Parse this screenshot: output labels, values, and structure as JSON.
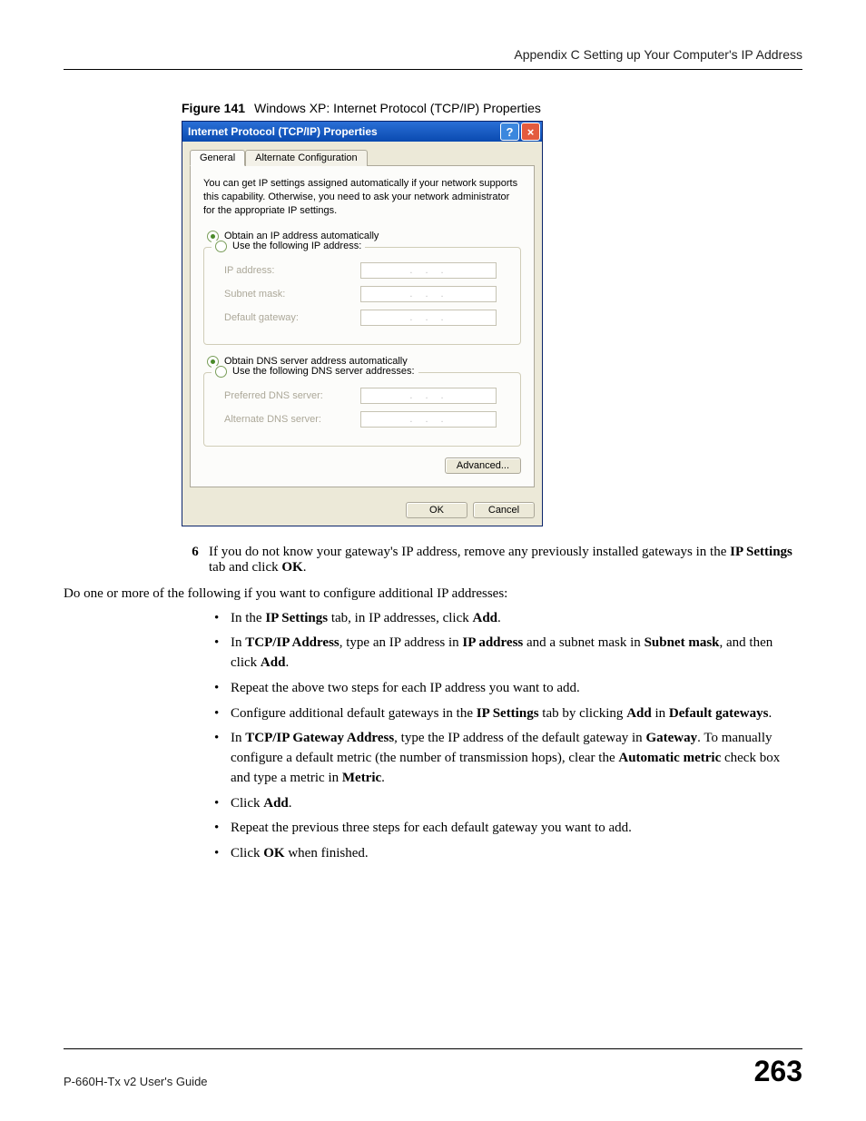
{
  "header": {
    "appendix": "Appendix C Setting up Your Computer's IP Address"
  },
  "figure": {
    "label": "Figure 141",
    "caption": "Windows XP: Internet Protocol (TCP/IP) Properties"
  },
  "dialog": {
    "title": "Internet Protocol (TCP/IP) Properties",
    "tabs": {
      "general": "General",
      "alt": "Alternate Configuration"
    },
    "description": "You can get IP settings assigned automatically if your network supports this capability. Otherwise, you need to ask your network administrator for the appropriate IP settings.",
    "radio_ip_auto": "Obtain an IP address automatically",
    "radio_ip_manual": "Use the following IP address:",
    "fields": {
      "ip_address": "IP address:",
      "subnet_mask": "Subnet mask:",
      "default_gateway": "Default gateway:"
    },
    "radio_dns_auto": "Obtain DNS server address automatically",
    "radio_dns_manual": "Use the following DNS server addresses:",
    "dns_fields": {
      "preferred": "Preferred DNS server:",
      "alternate": "Alternate DNS server:"
    },
    "advanced": "Advanced...",
    "ok": "OK",
    "cancel": "Cancel",
    "ip_placeholder": "..."
  },
  "step6": {
    "num": "6",
    "text_a": "If you do not know your gateway's IP address, remove any previously installed gateways in the ",
    "bold_a": "IP Settings",
    "text_b": " tab and click ",
    "bold_b": "OK",
    "text_c": "."
  },
  "intro": "Do one or more of the following if you want to configure additional IP addresses:",
  "bullets": {
    "b1": {
      "a": "In the ",
      "b1": "IP Settings",
      "b": " tab, in IP addresses, click ",
      "b2": "Add",
      "c": "."
    },
    "b2": {
      "a": "In ",
      "b1": "TCP/IP Address",
      "b": ", type an IP address in ",
      "b2": "IP address",
      "c": " and a subnet mask in ",
      "b3": "Subnet mask",
      "d": ", and then click ",
      "b4": "Add",
      "e": "."
    },
    "b3": {
      "a": "Repeat the above two steps for each IP address you want to add."
    },
    "b4": {
      "a": "Configure additional default gateways in the ",
      "b1": "IP Settings",
      "b": " tab by clicking ",
      "b2": "Add",
      "c": " in ",
      "b3": "Default gateways",
      "d": "."
    },
    "b5": {
      "a": "In ",
      "b1": "TCP/IP Gateway Address",
      "b": ", type the IP address of the default gateway in ",
      "b2": "Gateway",
      "c": ". To manually configure a default metric (the number of transmission hops), clear the ",
      "b3": "Automatic metric",
      "d": " check box and type a metric in ",
      "b4": "Metric",
      "e": "."
    },
    "b6": {
      "a": "Click ",
      "b1": "Add",
      "b": "."
    },
    "b7": {
      "a": "Repeat the previous three steps for each default gateway you want to add."
    },
    "b8": {
      "a": "Click ",
      "b1": "OK",
      "b": " when finished."
    }
  },
  "footer": {
    "guide": "P-660H-Tx v2 User's Guide",
    "page": "263"
  }
}
